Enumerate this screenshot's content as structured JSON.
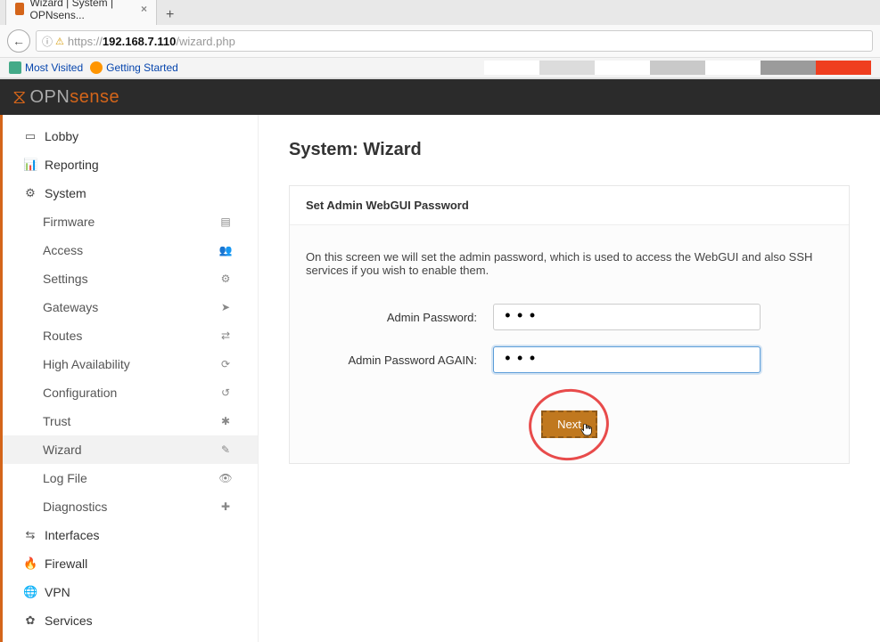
{
  "browser": {
    "tab_title": "Wizard | System | OPNsens...",
    "url_scheme": "https://",
    "url_host": "192.168.7.110",
    "url_path": "/wizard.php",
    "bookmarks": [
      "Most Visited",
      "Getting Started"
    ]
  },
  "brand": {
    "grey": "OPN",
    "orange": "sense"
  },
  "nav": {
    "lobby": "Lobby",
    "reporting": "Reporting",
    "system": "System",
    "interfaces": "Interfaces",
    "firewall": "Firewall",
    "vpn": "VPN",
    "services": "Services",
    "system_children": [
      {
        "label": "Firmware"
      },
      {
        "label": "Access"
      },
      {
        "label": "Settings"
      },
      {
        "label": "Gateways"
      },
      {
        "label": "Routes"
      },
      {
        "label": "High Availability"
      },
      {
        "label": "Configuration"
      },
      {
        "label": "Trust"
      },
      {
        "label": "Wizard"
      },
      {
        "label": "Log File"
      },
      {
        "label": "Diagnostics"
      }
    ]
  },
  "page": {
    "title": "System: Wizard",
    "panel_title": "Set Admin WebGUI Password",
    "description": "On this screen we will set the admin password, which is used to access the WebGUI and also SSH services if you wish to enable them.",
    "label_pw": "Admin Password:",
    "label_pw2": "Admin Password AGAIN:",
    "pw_value": "•••",
    "pw2_value": "•••",
    "next": "Next"
  },
  "colors": {
    "strip": [
      "#ffffff",
      "#dcdcdc",
      "#ffffff",
      "#c9c9c9",
      "#ffffff",
      "#9b9b9b",
      "#ef3e1f"
    ]
  }
}
